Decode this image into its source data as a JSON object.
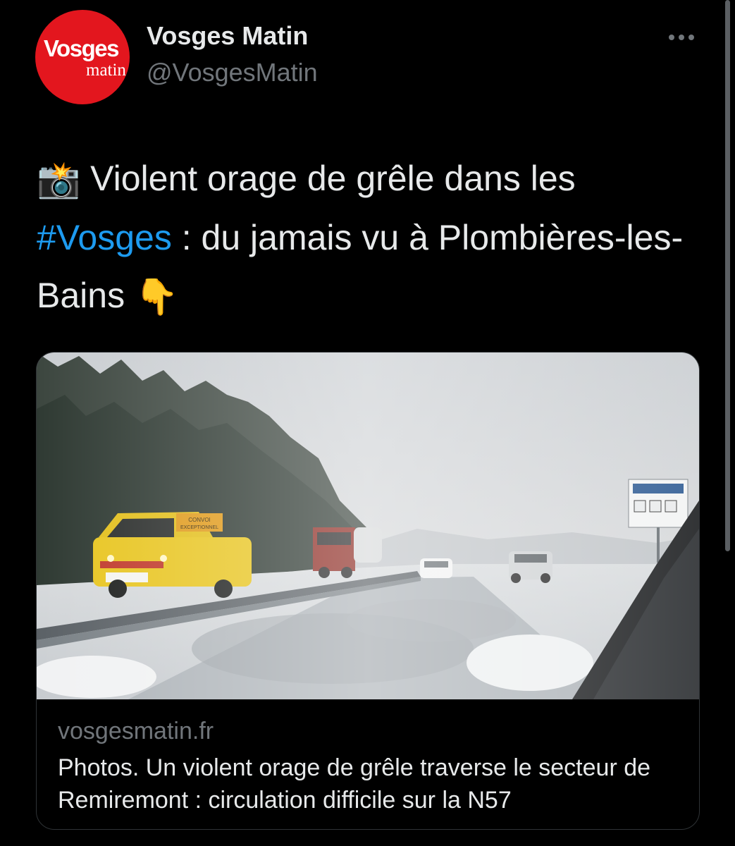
{
  "tweet": {
    "author": {
      "name": "Vosges Matin",
      "handle": "@VosgesMatin",
      "avatar_logo": "Vosges",
      "avatar_logo_sub": "matin",
      "avatar_color": "#e3161e"
    },
    "more_icon": "more-horizontal-icon",
    "text": {
      "emoji_camera": "📸",
      "before_hashtag": "Violent orage de grêle dans les",
      "hashtag": "#Vosges",
      "after_hashtag": ": du jamais vu à Plombières-les-Bains",
      "emoji_point": "👇"
    },
    "card": {
      "domain": "vosgesmatin.fr",
      "title": "Photos. Un violent orage de grêle traverse le secteur de Remiremont : circulation difficile sur la N57",
      "image_icon": "photo-hailstorm-road",
      "van_sign": "CONVOI EXCEPTIONNEL"
    }
  },
  "colors": {
    "background": "#000000",
    "text": "#e7e9ea",
    "secondary_text": "#71767b",
    "link": "#1d9bf0",
    "border": "#2f3336"
  }
}
